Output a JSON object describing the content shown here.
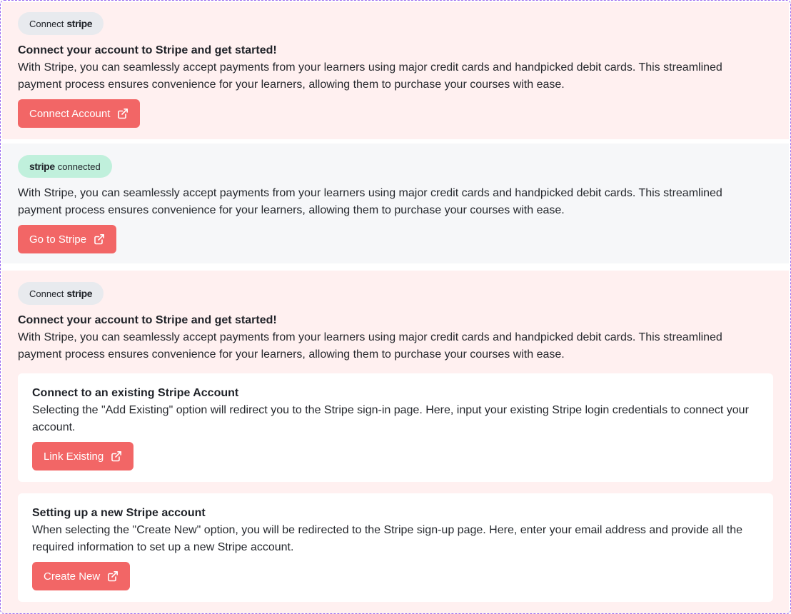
{
  "section1": {
    "badge": {
      "prefix": "Connect",
      "brand": "stripe"
    },
    "heading": "Connect your account to Stripe and get started!",
    "description": "With Stripe, you can seamlessly accept payments from your learners using major credit cards and handpicked debit cards. This streamlined payment process ensures convenience for your learners, allowing them to purchase your courses with ease.",
    "button_label": "Connect Account"
  },
  "section2": {
    "badge": {
      "brand": "stripe",
      "suffix": "connected"
    },
    "description": "With Stripe, you can seamlessly accept payments from your learners using major credit cards and handpicked debit cards. This streamlined payment process ensures convenience for your learners, allowing them to purchase your courses with ease.",
    "button_label": "Go to Stripe"
  },
  "section3": {
    "badge": {
      "prefix": "Connect",
      "brand": "stripe"
    },
    "heading": "Connect your account to Stripe and get started!",
    "description": "With Stripe, you can seamlessly accept payments from your learners using major credit cards and handpicked debit cards. This streamlined payment process ensures convenience for your learners, allowing them to purchase your courses with ease.",
    "existing": {
      "title": "Connect to an existing Stripe Account",
      "description": "Selecting the \"Add Existing\" option will redirect you to the Stripe sign-in page. Here, input your existing Stripe login credentials to connect your account.",
      "button_label": "Link Existing"
    },
    "new": {
      "title": "Setting up a new Stripe account",
      "description": "When selecting the \"Create New\" option, you will be redirected to the Stripe sign-up page. Here, enter your email address and provide all the required information to set up a new Stripe account.",
      "button_label": "Create New"
    }
  },
  "icons": {
    "button_icon": "external-link-icon"
  },
  "colors": {
    "button": "#f26666",
    "panel_pink": "#fff0f0",
    "panel_gray": "#f6f7f9",
    "badge_gray": "#e8eaee",
    "badge_green": "#c0f0dc",
    "frame_border": "#9b6bf0"
  }
}
